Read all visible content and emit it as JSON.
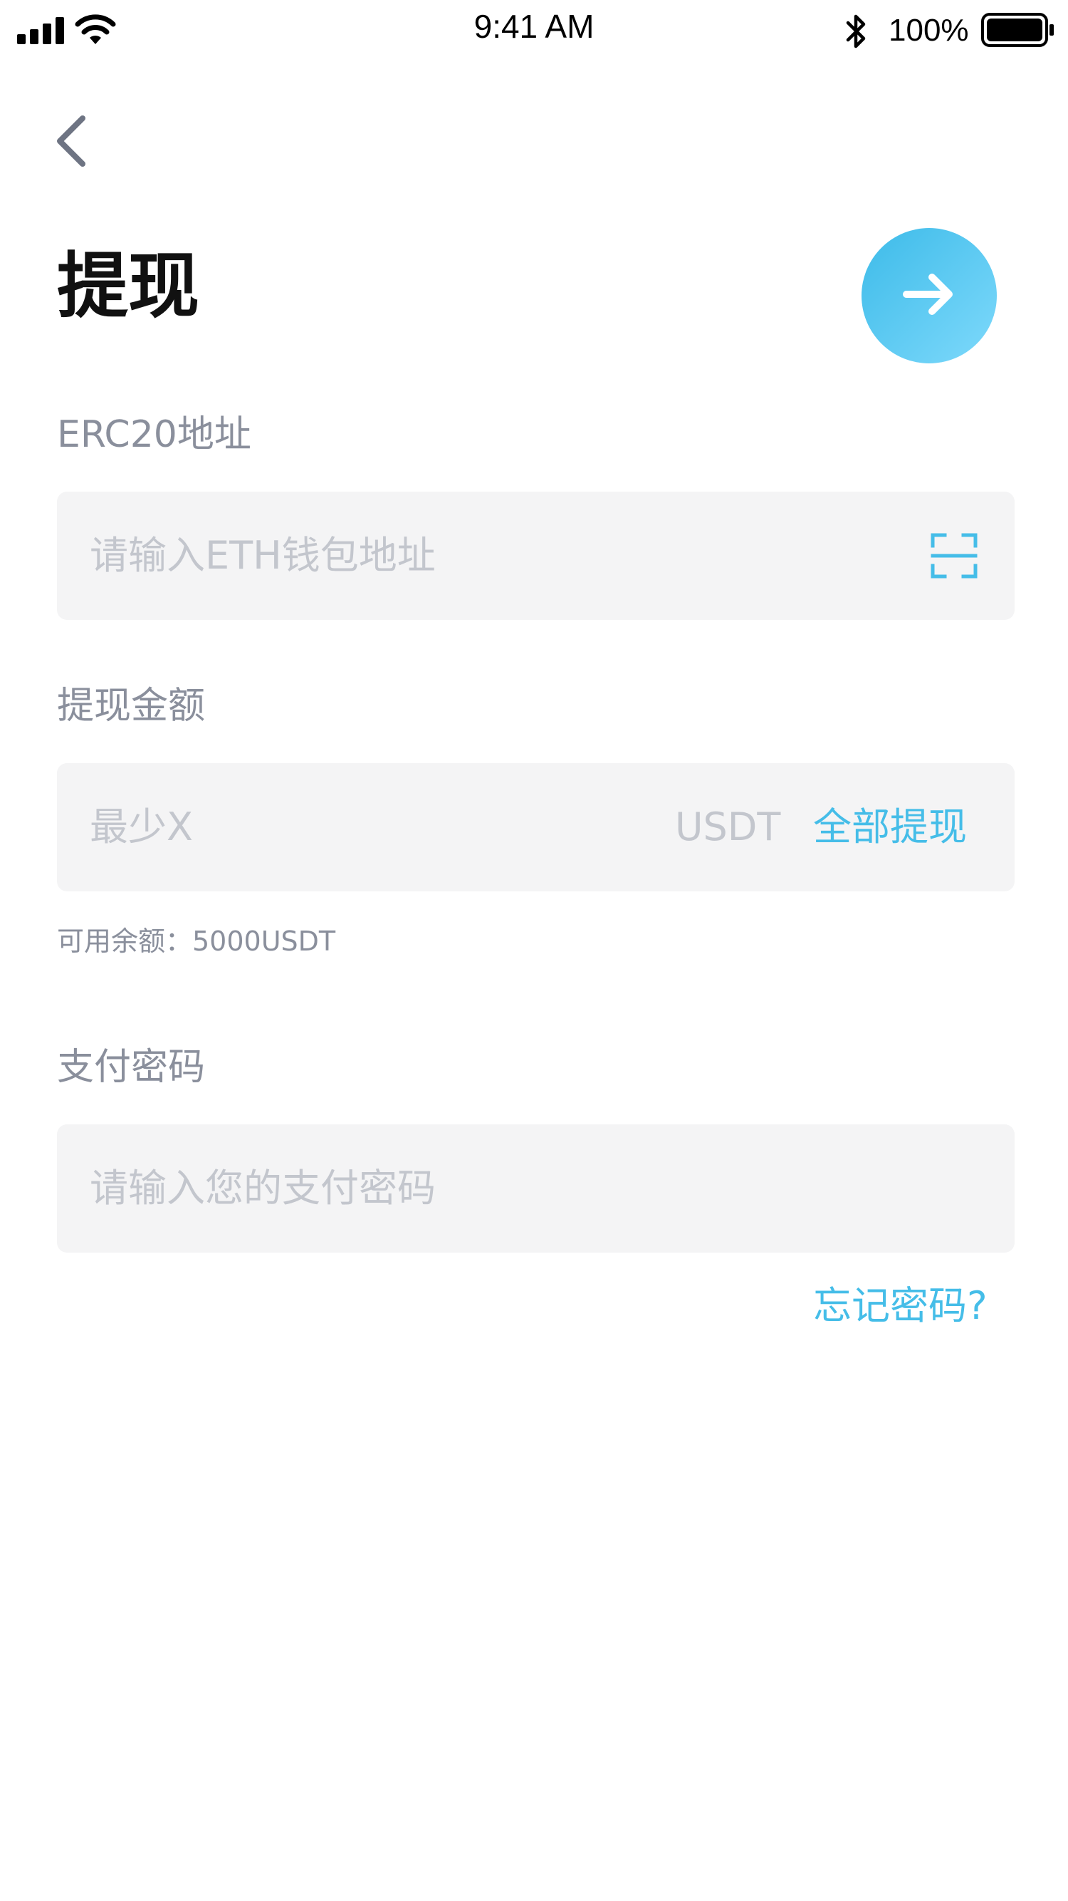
{
  "status_bar": {
    "time": "9:41 AM",
    "battery_percent": "100%",
    "icons": [
      "signal-icon",
      "wifi-icon",
      "bluetooth-icon",
      "battery-icon"
    ]
  },
  "header": {
    "back_icon": "chevron-left-icon",
    "title": "提现",
    "next_icon": "arrow-right-icon"
  },
  "address": {
    "label": "ERC20地址",
    "placeholder": "请输入ETH钱包地址",
    "scan_icon": "scan-icon"
  },
  "amount": {
    "label": "提现金额",
    "placeholder": "最少X",
    "unit": "USDT",
    "withdraw_all": "全部提现",
    "balance": "可用余额：5000USDT"
  },
  "password": {
    "label": "支付密码",
    "placeholder": "请输入您的支付密码",
    "forgot": "忘记密码?"
  },
  "colors": {
    "accent": "#45bde8",
    "gradient_start": "#3dbbe9",
    "gradient_end": "#7ed9fb",
    "input_bg": "#f4f4f5",
    "label": "#8a8f9c",
    "placeholder": "#c3c6cd",
    "title": "#111111"
  }
}
